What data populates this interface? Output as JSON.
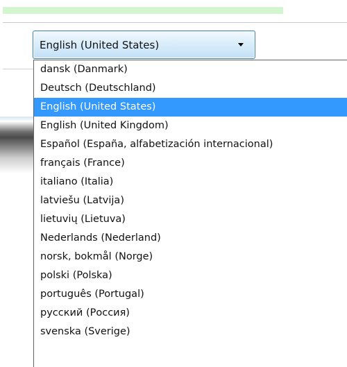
{
  "language_selector": {
    "selected": "English (United States)",
    "arrow_icon": "chevron-down-icon",
    "options": [
      "dansk (Danmark)",
      "Deutsch (Deutschland)",
      "English (United States)",
      "English (United Kingdom)",
      "Español (España, alfabetización internacional)",
      "français (France)",
      "italiano (Italia)",
      "latviešu (Latvija)",
      "lietuvių (Lietuva)",
      "Nederlands (Nederland)",
      "norsk, bokmål (Norge)",
      "polski (Polska)",
      "português (Portugal)",
      "русский (Россия)",
      "svenska (Sverige)"
    ],
    "highlighted_index": 2
  },
  "colors": {
    "highlight": "#3399ff",
    "progress_fill": "#d3f5cf",
    "combo_border": "#3c7fb1"
  }
}
